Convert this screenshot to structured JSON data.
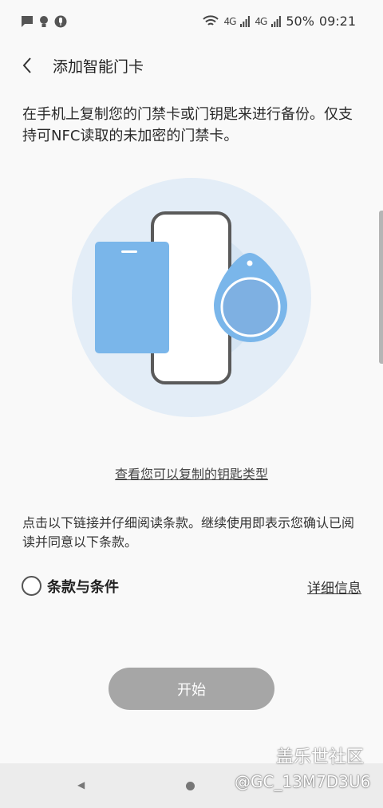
{
  "status_bar": {
    "battery": "50%",
    "time": "09:21",
    "signal_1": "4G",
    "signal_2": "4G"
  },
  "header": {
    "title": "添加智能门卡"
  },
  "main": {
    "description": "在手机上复制您的门禁卡或门钥匙来进行备份。仅支持可NFC读取的未加密的门禁卡。",
    "key_types_link": "查看您可以复制的钥匙类型",
    "terms_notice": "点击以下链接并仔细阅读条款。继续使用即表示您确认已阅读并同意以下条款。",
    "terms_label": "条款与条件",
    "details_link": "详细信息",
    "start_button": "开始"
  },
  "watermark": {
    "brand": "盖乐世社区",
    "user": "@GC_13M7D3U6"
  },
  "colors": {
    "background": "#f9f9f9",
    "illustration_circle": "#dde9f5",
    "card_blue": "#7db7ea",
    "button_disabled": "#a6a6a6"
  }
}
